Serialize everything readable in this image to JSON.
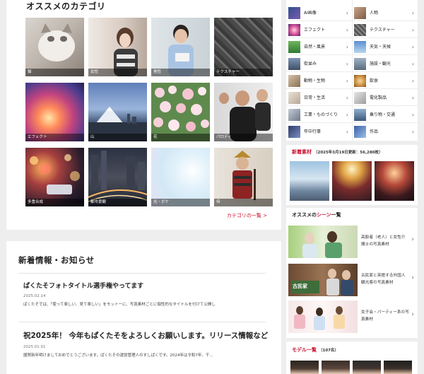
{
  "categories_section": {
    "title": "オススメのカテゴリ",
    "tiles": [
      {
        "label": "猫"
      },
      {
        "label": "女性"
      },
      {
        "label": "男性"
      },
      {
        "label": "テクスチャー"
      },
      {
        "label": "エフェクト"
      },
      {
        "label": "山"
      },
      {
        "label": "花"
      },
      {
        "label": "パロディ"
      },
      {
        "label": "多重合成"
      },
      {
        "label": "都市景観"
      },
      {
        "label": "光・ボケ"
      },
      {
        "label": "侍"
      }
    ],
    "more_link": "カテゴリの一覧 >"
  },
  "news": {
    "heading": "新着情報・お知らせ",
    "items": [
      {
        "title": "ぱくたそフォトタイトル選手権やってます",
        "date": "2025.02.14",
        "excerpt": "ぱくたそでは、「使って楽しい、見て楽しい」をモットーに、写真素材ごとに個性的なタイトルを付けて公開し"
      },
      {
        "title": "祝2025年！ 今年もぱくたそをよろしくお願いします。リリース情報など",
        "date": "2025.01.01",
        "excerpt": "謹賀新年明けましておめでとうございます。ぱくたその運営管理人のすしぱくです。2024年は令和7年、干..."
      }
    ]
  },
  "sidebar": {
    "category_grid": [
      {
        "left": "AI画像",
        "right": "人物"
      },
      {
        "left": "エフェクト",
        "right": "テクスチャー"
      },
      {
        "left": "自然・風景",
        "right": "天気・天候"
      },
      {
        "left": "街並み",
        "right": "施設・観光"
      },
      {
        "left": "動物・生物",
        "right": "飲食"
      },
      {
        "left": "日常・生活",
        "right": "電化製品"
      },
      {
        "left": "工業・ものづくり",
        "right": "乗り物・交通"
      },
      {
        "left": "年中行事",
        "right": "作品"
      }
    ],
    "chevron": "›",
    "new_materials": {
      "title": "新着素材",
      "subtitle": "（2025年3月19日更新：56,280枚）"
    },
    "scenes": {
      "title_prefix": "オススメの",
      "title_highlight": "シーン",
      "title_suffix": "一覧",
      "items": [
        {
          "text": "高齢者（老人）と女性介護士の写真素材"
        },
        {
          "text": "古民家と英語する外国人観光客の写真素材"
        },
        {
          "text": "女子会・パーティー系の写真素材"
        }
      ],
      "scene2_banner": "古民家"
    },
    "models": {
      "title": "モデル一覧",
      "count": "（107名）"
    }
  },
  "colors": {
    "accent": "#c8102e",
    "background": "#eeeeee",
    "card": "#ffffff"
  }
}
